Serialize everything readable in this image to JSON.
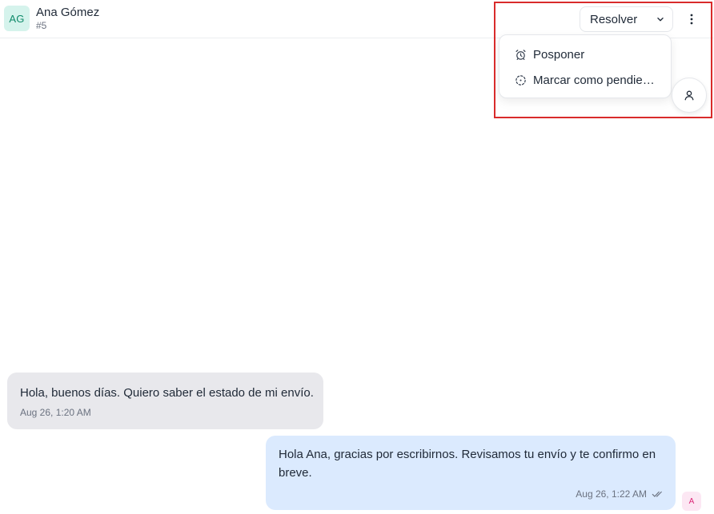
{
  "header": {
    "avatar_initials": "AG",
    "contact_name": "Ana Gómez",
    "conversation_id": "#5",
    "resolve_label": "Resolver"
  },
  "dropdown": {
    "items": [
      {
        "label": "Posponer",
        "icon": "alarm-clock-icon"
      },
      {
        "label": "Marcar como pendiente",
        "icon": "dashed-circle-icon"
      }
    ]
  },
  "messages": [
    {
      "direction": "incoming",
      "text": "Hola, buenos días. Quiero saber el estado de mi envío.",
      "time": "Aug 26, 1:20 AM"
    },
    {
      "direction": "outgoing",
      "text": "Hola Ana, gracias por escribirnos. Revisamos tu envío y te confirmo en breve.",
      "time": "Aug 26, 1:22 AM",
      "status_icon": "double-check-icon",
      "sender_initial": "A"
    }
  ],
  "colors": {
    "incoming_bubble": "#e8e8ec",
    "outgoing_bubble": "#dbeafe",
    "avatar_bg": "#d5f3ec",
    "highlight": "#d92b2b"
  }
}
